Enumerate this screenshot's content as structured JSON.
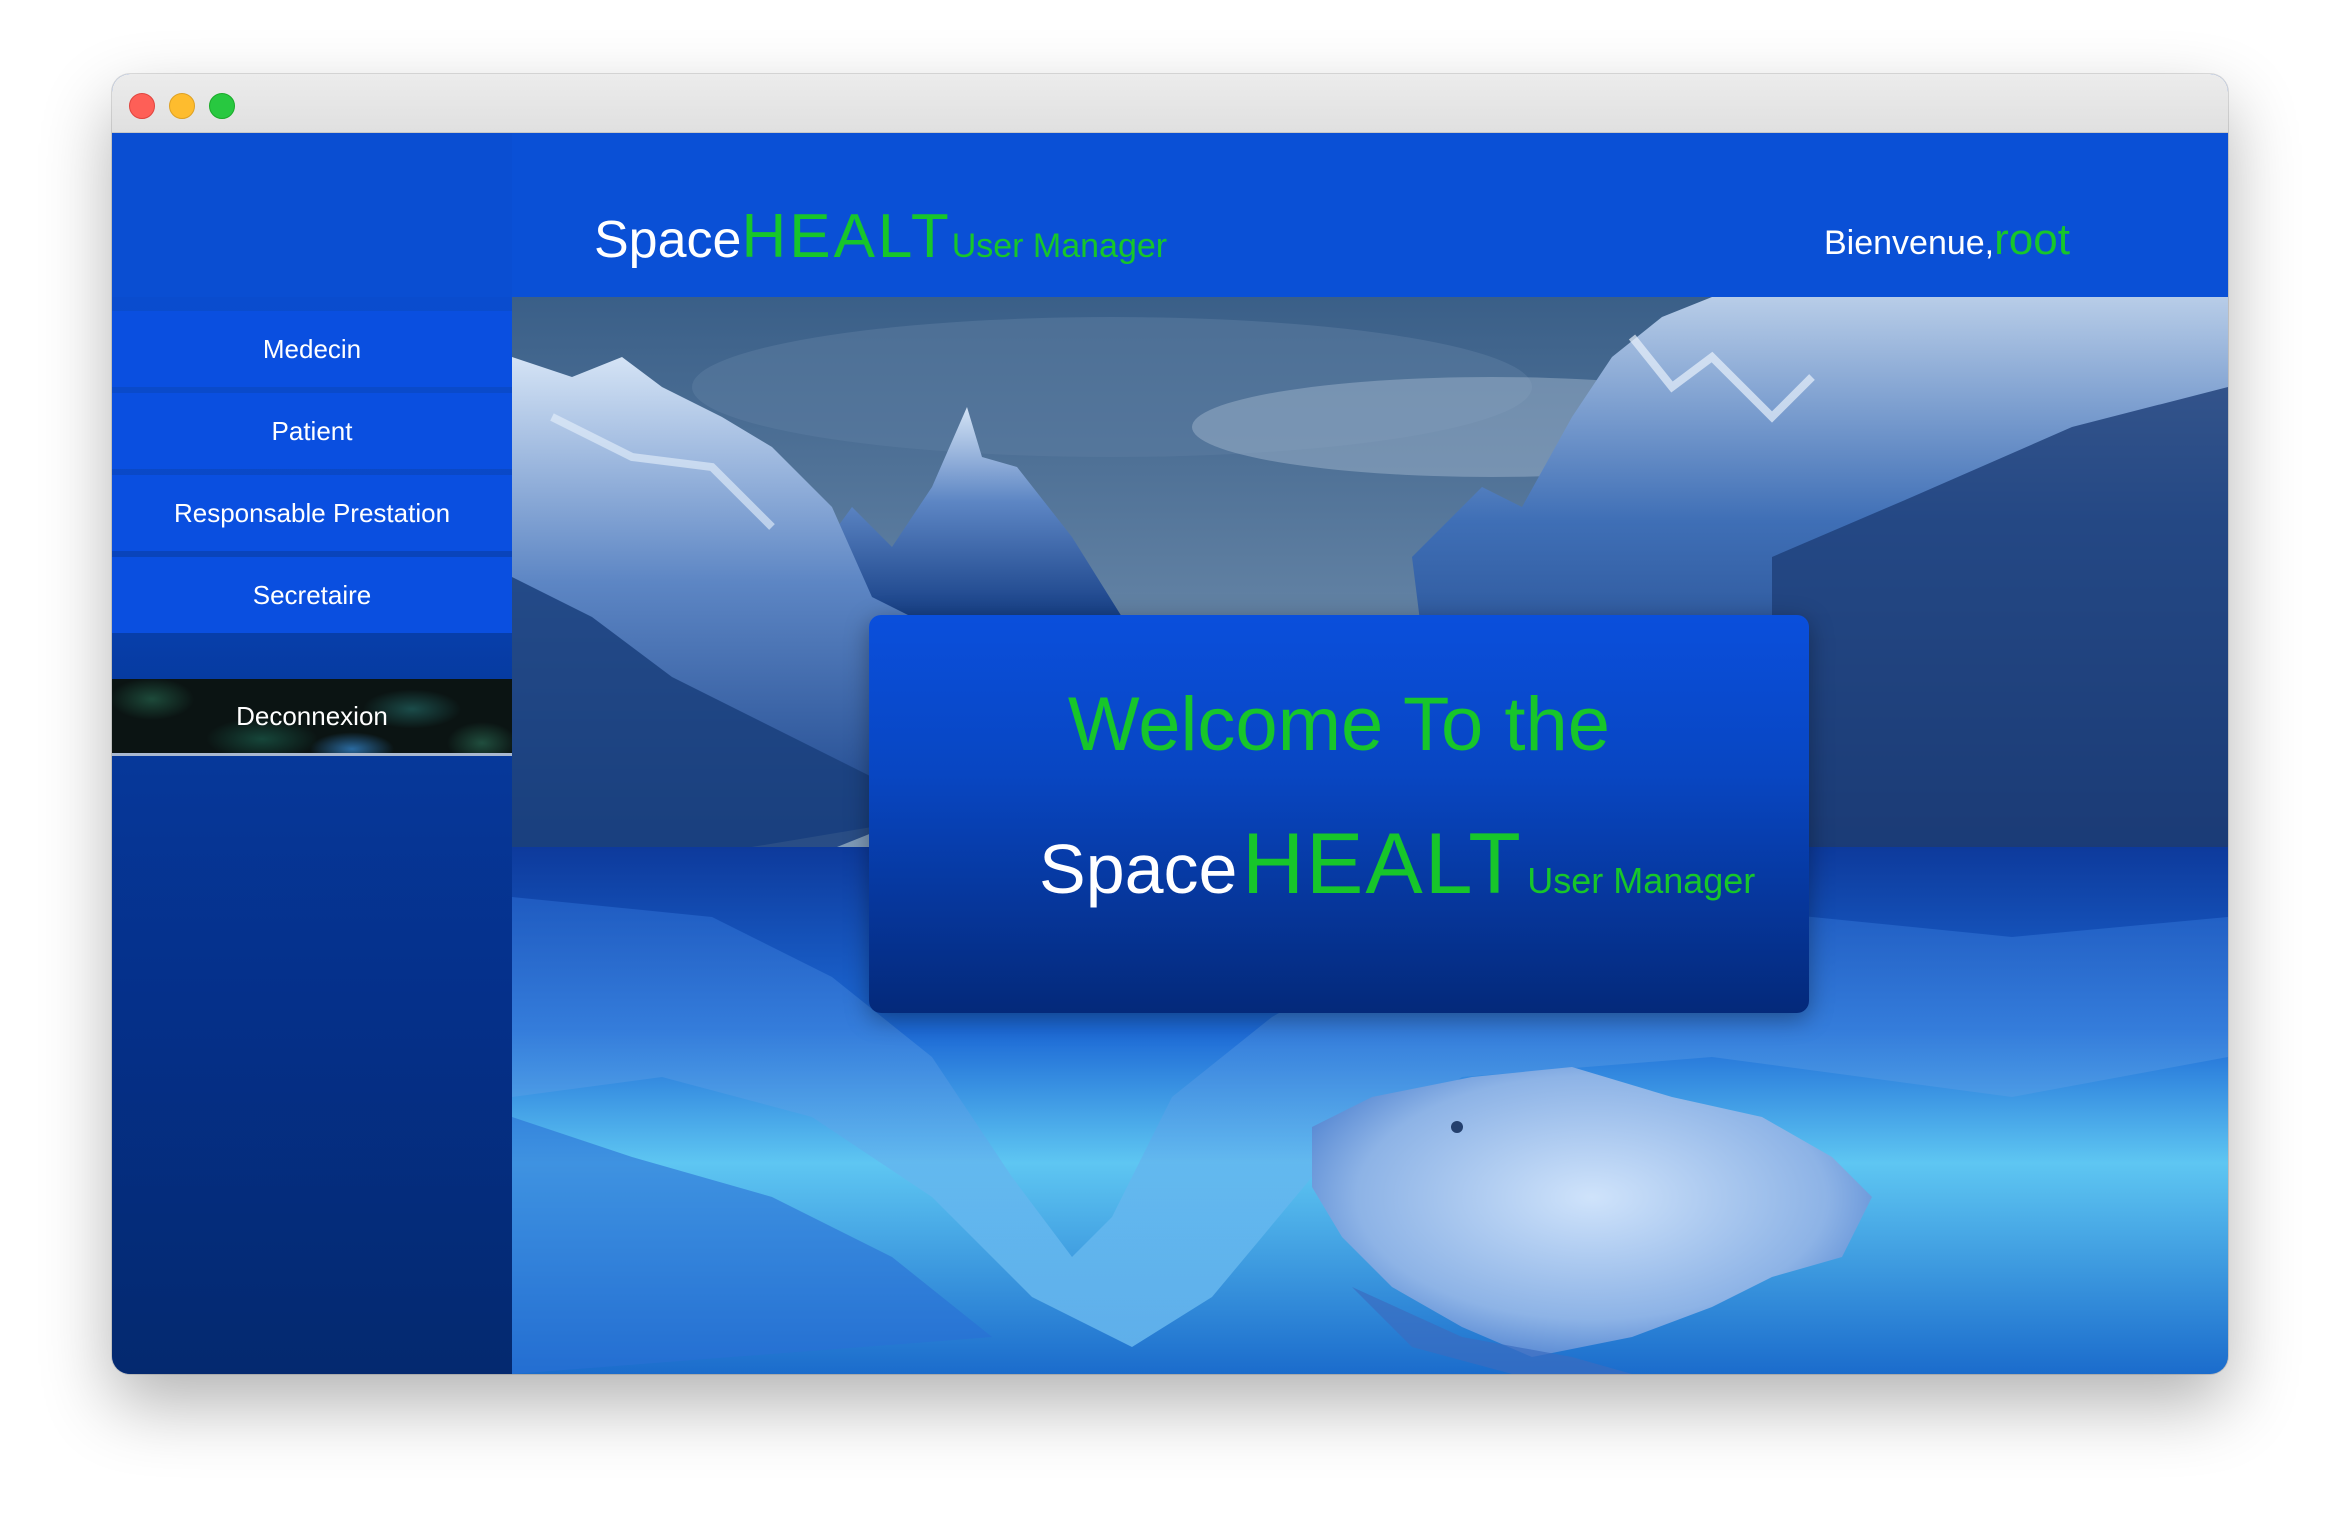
{
  "header": {
    "brand_space": "Space",
    "brand_healt": "HEALT",
    "brand_user_manager": "User Manager",
    "welcome_label": "Bienvenue,",
    "username": "root"
  },
  "sidebar": {
    "items": [
      {
        "label": "Medecin"
      },
      {
        "label": "Patient"
      },
      {
        "label": "Responsable Prestation"
      },
      {
        "label": "Secretaire"
      }
    ],
    "logout_label": "Deconnexion"
  },
  "card": {
    "line1": "Welcome To the",
    "space": "Space",
    "healt": "HEALT",
    "user_manager": "User Manager"
  },
  "colors": {
    "primary_blue": "#0a50d6",
    "accent_green": "#17c62a"
  }
}
